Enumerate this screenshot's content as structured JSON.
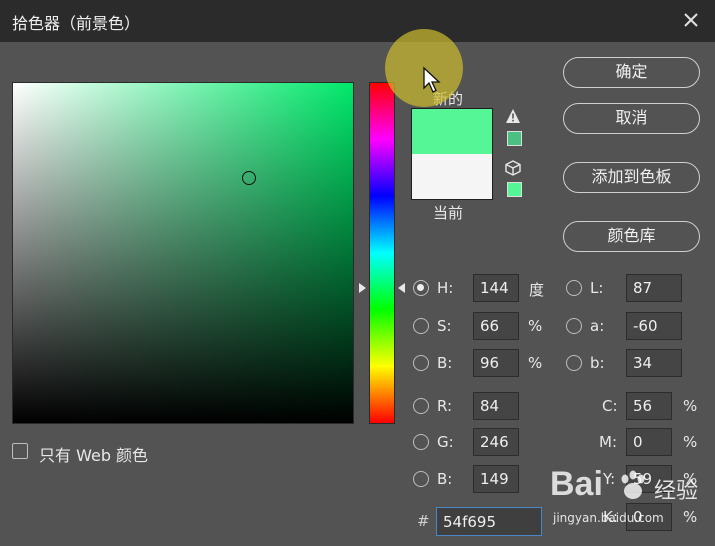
{
  "window": {
    "title": "拾色器（前景色）"
  },
  "preview": {
    "new_label": "新的",
    "current_label": "当前",
    "new_color": "#54f695",
    "current_color": "#f5f5f5"
  },
  "buttons": {
    "ok": "确定",
    "cancel": "取消",
    "add_to_swatches": "添加到色板",
    "color_libraries": "颜色库"
  },
  "fields": {
    "H": {
      "label": "H:",
      "value": "144",
      "unit": "度",
      "selected": true
    },
    "S": {
      "label": "S:",
      "value": "66",
      "unit": "%"
    },
    "Bri": {
      "label": "B:",
      "value": "96",
      "unit": "%"
    },
    "R": {
      "label": "R:",
      "value": "84"
    },
    "G": {
      "label": "G:",
      "value": "246"
    },
    "Blue": {
      "label": "B:",
      "value": "149"
    },
    "L": {
      "label": "L:",
      "value": "87"
    },
    "a": {
      "label": "a:",
      "value": "-60"
    },
    "b": {
      "label": "b:",
      "value": "34"
    },
    "C": {
      "label": "C:",
      "value": "56",
      "unit": "%"
    },
    "M": {
      "label": "M:",
      "value": "0",
      "unit": "%"
    },
    "Y": {
      "label": "Y:",
      "value": "59",
      "unit": "%"
    },
    "K": {
      "label": "K:",
      "value": "0",
      "unit": "%"
    }
  },
  "hex": {
    "label": "#",
    "value": "54f695"
  },
  "web_only": {
    "label": "只有 Web 颜色",
    "checked": false
  },
  "watermark": {
    "logo_text": "Bai",
    "cn_text": "经验",
    "url": "jingyan.baidu.com"
  },
  "colors": {
    "picked": "#54f695",
    "gamut_warning": "#4cbf83",
    "titlebar": "#2b2b2b",
    "panel": "#535353"
  },
  "icons": {
    "close": "close-icon",
    "gamut_warning": "warning-triangle-icon",
    "web_safe": "cube-icon",
    "cursor": "mouse-cursor-icon"
  }
}
